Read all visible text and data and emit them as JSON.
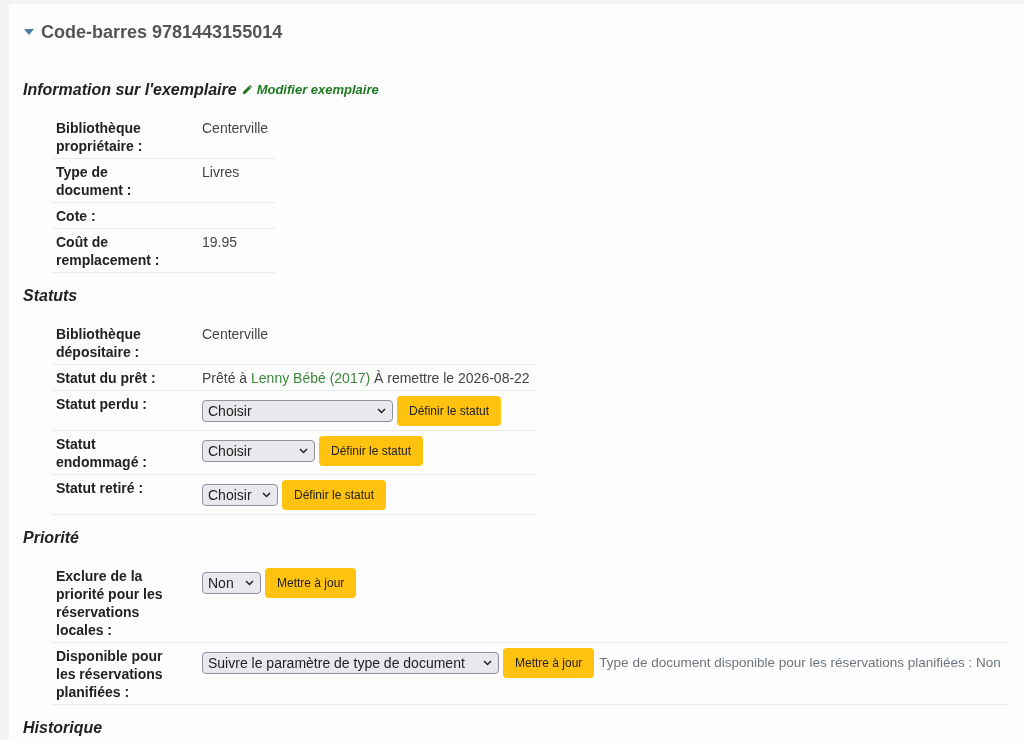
{
  "item": {
    "title": "Code-barres 9781443155014",
    "expanded": true
  },
  "sections": [
    {
      "title": "Information sur l'exemplaire",
      "link": "Modifier exemplaire",
      "rows": [
        {
          "kind": "text",
          "label": "Bibliothèque propriétaire :",
          "value": "Centerville"
        },
        {
          "kind": "text",
          "label": "Type de document :",
          "value": "Livres"
        },
        {
          "kind": "text",
          "label": "Cote :"
        },
        {
          "kind": "text",
          "label": "Coût de remplacement :",
          "value": "19.95"
        }
      ]
    },
    {
      "title": "Statuts",
      "rows": [
        {
          "kind": "text",
          "label": "Bibliothèque dépositaire :",
          "value": "Centerville"
        },
        {
          "kind": "loan",
          "label": "Statut du prêt :",
          "prefix": "Prêté à",
          "patron": "Lenny Bébé (2017)",
          "suffix": "À remettre le 2026-08-22"
        },
        {
          "kind": "select",
          "label": "Statut perdu :",
          "value": "Choisir",
          "button": "Définir le statut"
        },
        {
          "kind": "select",
          "label": "Statut endommagé :",
          "value": "Choisir",
          "button": "Définir le statut"
        },
        {
          "kind": "select",
          "label": "Statut retiré :",
          "value": "Choisir",
          "button": "Définir le statut"
        }
      ]
    },
    {
      "title": "Priorité",
      "rows": [
        {
          "kind": "select",
          "label": "Exclure de la priorité pour les réservations locales :",
          "value": "Non",
          "button": "Mettre à jour"
        },
        {
          "kind": "select",
          "label": "Disponible pour les réservations planifiées :",
          "value": "Suivre le paramètre de type de document",
          "button": "Mettre à jour",
          "note": "Type de document disponible pour les réservations planifiées : Non"
        }
      ]
    },
    {
      "title": "Historique"
    }
  ]
}
